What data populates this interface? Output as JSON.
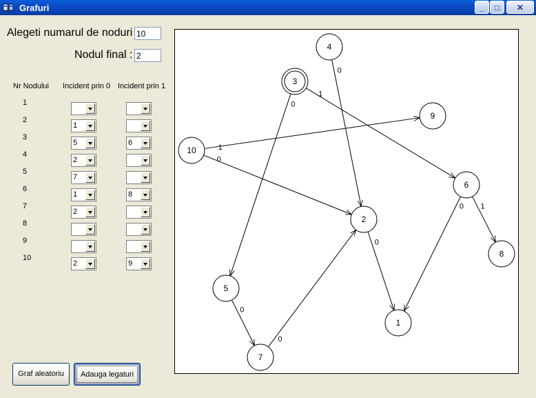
{
  "window": {
    "title": "Grafuri"
  },
  "form": {
    "num_nodes_label": "Alegeti numarul de noduri",
    "num_nodes_value": "10",
    "final_node_label": "Nodul final :",
    "final_node_value": "2"
  },
  "table": {
    "headers": [
      "Nr Nodului",
      "Incident prin 0",
      "Incident prin 1"
    ],
    "rows": [
      {
        "node": "1",
        "in0": "",
        "in1": ""
      },
      {
        "node": "2",
        "in0": "1",
        "in1": ""
      },
      {
        "node": "3",
        "in0": "5",
        "in1": "6"
      },
      {
        "node": "4",
        "in0": "2",
        "in1": ""
      },
      {
        "node": "5",
        "in0": "7",
        "in1": ""
      },
      {
        "node": "6",
        "in0": "1",
        "in1": "8"
      },
      {
        "node": "7",
        "in0": "2",
        "in1": ""
      },
      {
        "node": "8",
        "in0": "",
        "in1": ""
      },
      {
        "node": "9",
        "in0": "",
        "in1": ""
      },
      {
        "node": "10",
        "in0": "2",
        "in1": "9"
      }
    ]
  },
  "buttons": {
    "random_graph": "Graf aleatoriu",
    "add_links": "Adauga legaturi"
  },
  "graph": {
    "final_node": "3",
    "nodes": [
      "1",
      "2",
      "3",
      "4",
      "5",
      "6",
      "7",
      "8",
      "9",
      "10"
    ],
    "edges": [
      {
        "from": "2",
        "to": "1",
        "label": "0"
      },
      {
        "from": "3",
        "to": "5",
        "label": "0"
      },
      {
        "from": "3",
        "to": "6",
        "label": "1"
      },
      {
        "from": "4",
        "to": "2",
        "label": "0"
      },
      {
        "from": "5",
        "to": "7",
        "label": "0"
      },
      {
        "from": "6",
        "to": "1",
        "label": "0"
      },
      {
        "from": "6",
        "to": "8",
        "label": "1"
      },
      {
        "from": "7",
        "to": "2",
        "label": "0"
      },
      {
        "from": "10",
        "to": "2",
        "label": "0"
      },
      {
        "from": "10",
        "to": "9",
        "label": "1"
      }
    ]
  }
}
